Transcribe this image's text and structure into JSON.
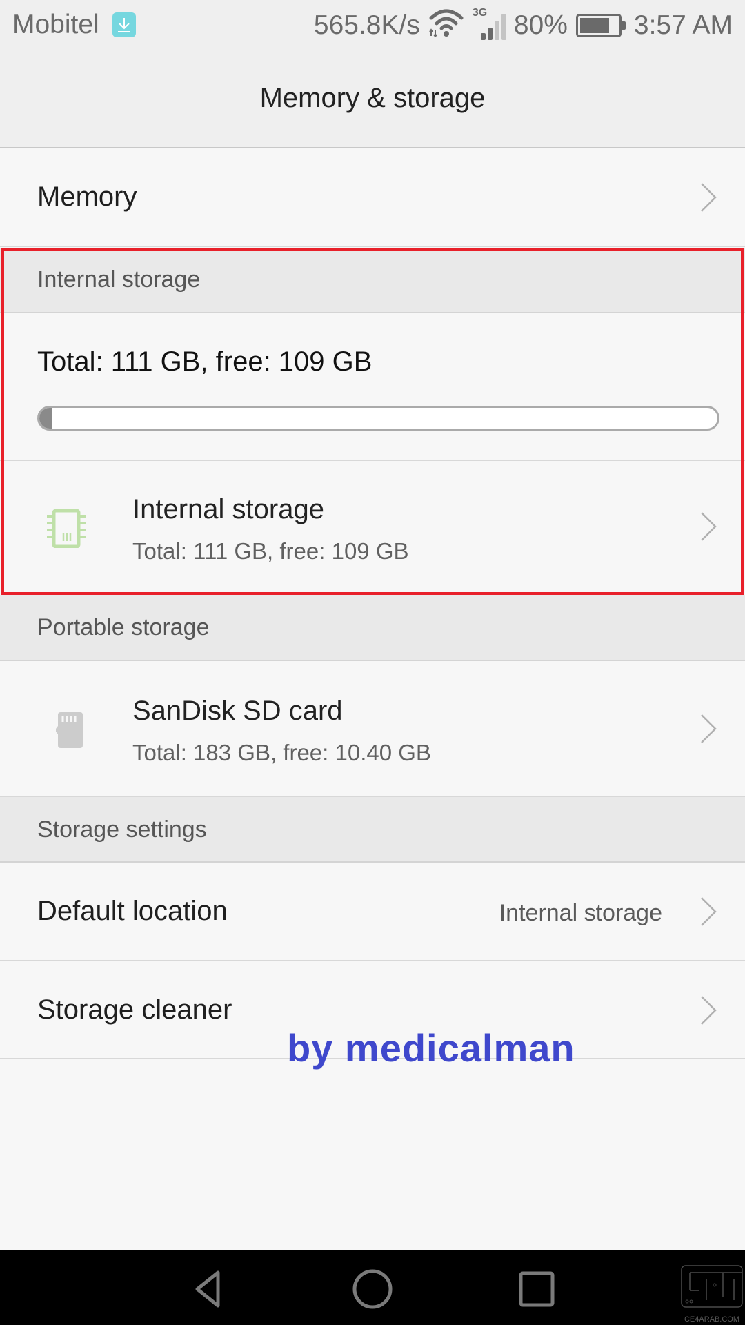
{
  "status_bar": {
    "carrier": "Mobitel",
    "notification_icon": "download-icon",
    "net_speed": "565.8K/s",
    "wifi_icon": "wifi-icon",
    "network_type": "3G",
    "signal_level_bars": 2,
    "signal_total_bars": 4,
    "battery_percent": "80%",
    "battery_level": 0.8,
    "time": "3:57 AM"
  },
  "header": {
    "title": "Memory & storage"
  },
  "memory_row": {
    "label": "Memory",
    "icon": "chevron-right-icon"
  },
  "internal_storage_section": {
    "header": "Internal storage",
    "summary": "Total: 111 GB, free: 109 GB",
    "usage_fraction": 0.018,
    "device": {
      "icon": "chip-icon",
      "title": "Internal storage",
      "subtitle": "Total: 111 GB, free: 109 GB"
    }
  },
  "portable_storage_section": {
    "header": "Portable storage",
    "device": {
      "icon": "sd-card-icon",
      "title": "SanDisk SD card",
      "subtitle": "Total: 183 GB, free: 10.40 GB"
    }
  },
  "storage_settings_section": {
    "header": "Storage settings",
    "items": [
      {
        "label": "Default location",
        "value": "Internal storage"
      },
      {
        "label": "Storage cleaner"
      }
    ]
  },
  "annotation": {
    "highlight_color": "#e8202a",
    "watermark": "by medicalman",
    "watermark_color": "#3f48cc",
    "site_watermark": "CE4ARAB.COM"
  },
  "nav_bar": {
    "buttons": [
      "back",
      "home",
      "recents"
    ]
  },
  "colors": {
    "chip_icon": "#bfe0a8",
    "sd_icon": "#cccccc",
    "notif_icon_bg": "#76d7df"
  }
}
